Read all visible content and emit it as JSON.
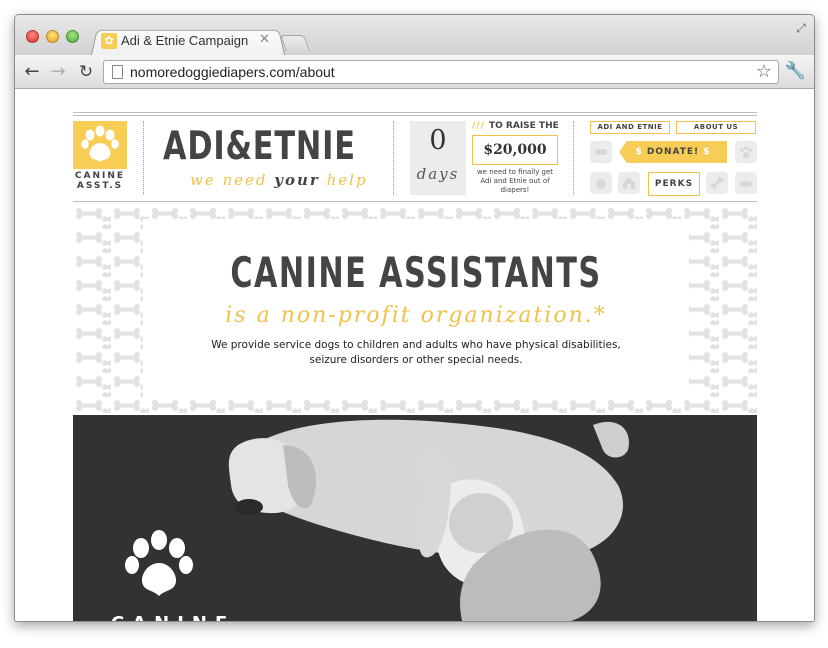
{
  "browser": {
    "tab_title": "Adi & Etnie Campaign",
    "url": "nomoredoggiediapers.com/about"
  },
  "header": {
    "logo_line1": "CANINE",
    "logo_line2": "ASST.S",
    "brand_title": "ADI&ETNIE",
    "tagline_we_need": "we need",
    "tagline_your": "your",
    "tagline_help": "help",
    "days_count": "0",
    "days_label": "days",
    "raise_label": "TO RAISE THE",
    "raise_amount": "$20,000",
    "raise_note": "we need to finally get Adi and Etnie out of diapers!",
    "nav_adi": "ADI AND ETNIE",
    "nav_about": "ABOUT US",
    "donate_label": "DONATE!",
    "donate_symbol": "$",
    "perks_label": "PERKS"
  },
  "hero": {
    "title": "CANINE ASSISTANTS",
    "subtitle": "is a non-profit organization.*",
    "body_line1": "We provide service dogs to children and adults who have physical disabilities,",
    "body_line2": "seizure disorders or other special needs."
  },
  "photo": {
    "caption": "CANINE"
  },
  "colors": {
    "accent_yellow": "#f7cd55",
    "text_dark": "#444444"
  }
}
